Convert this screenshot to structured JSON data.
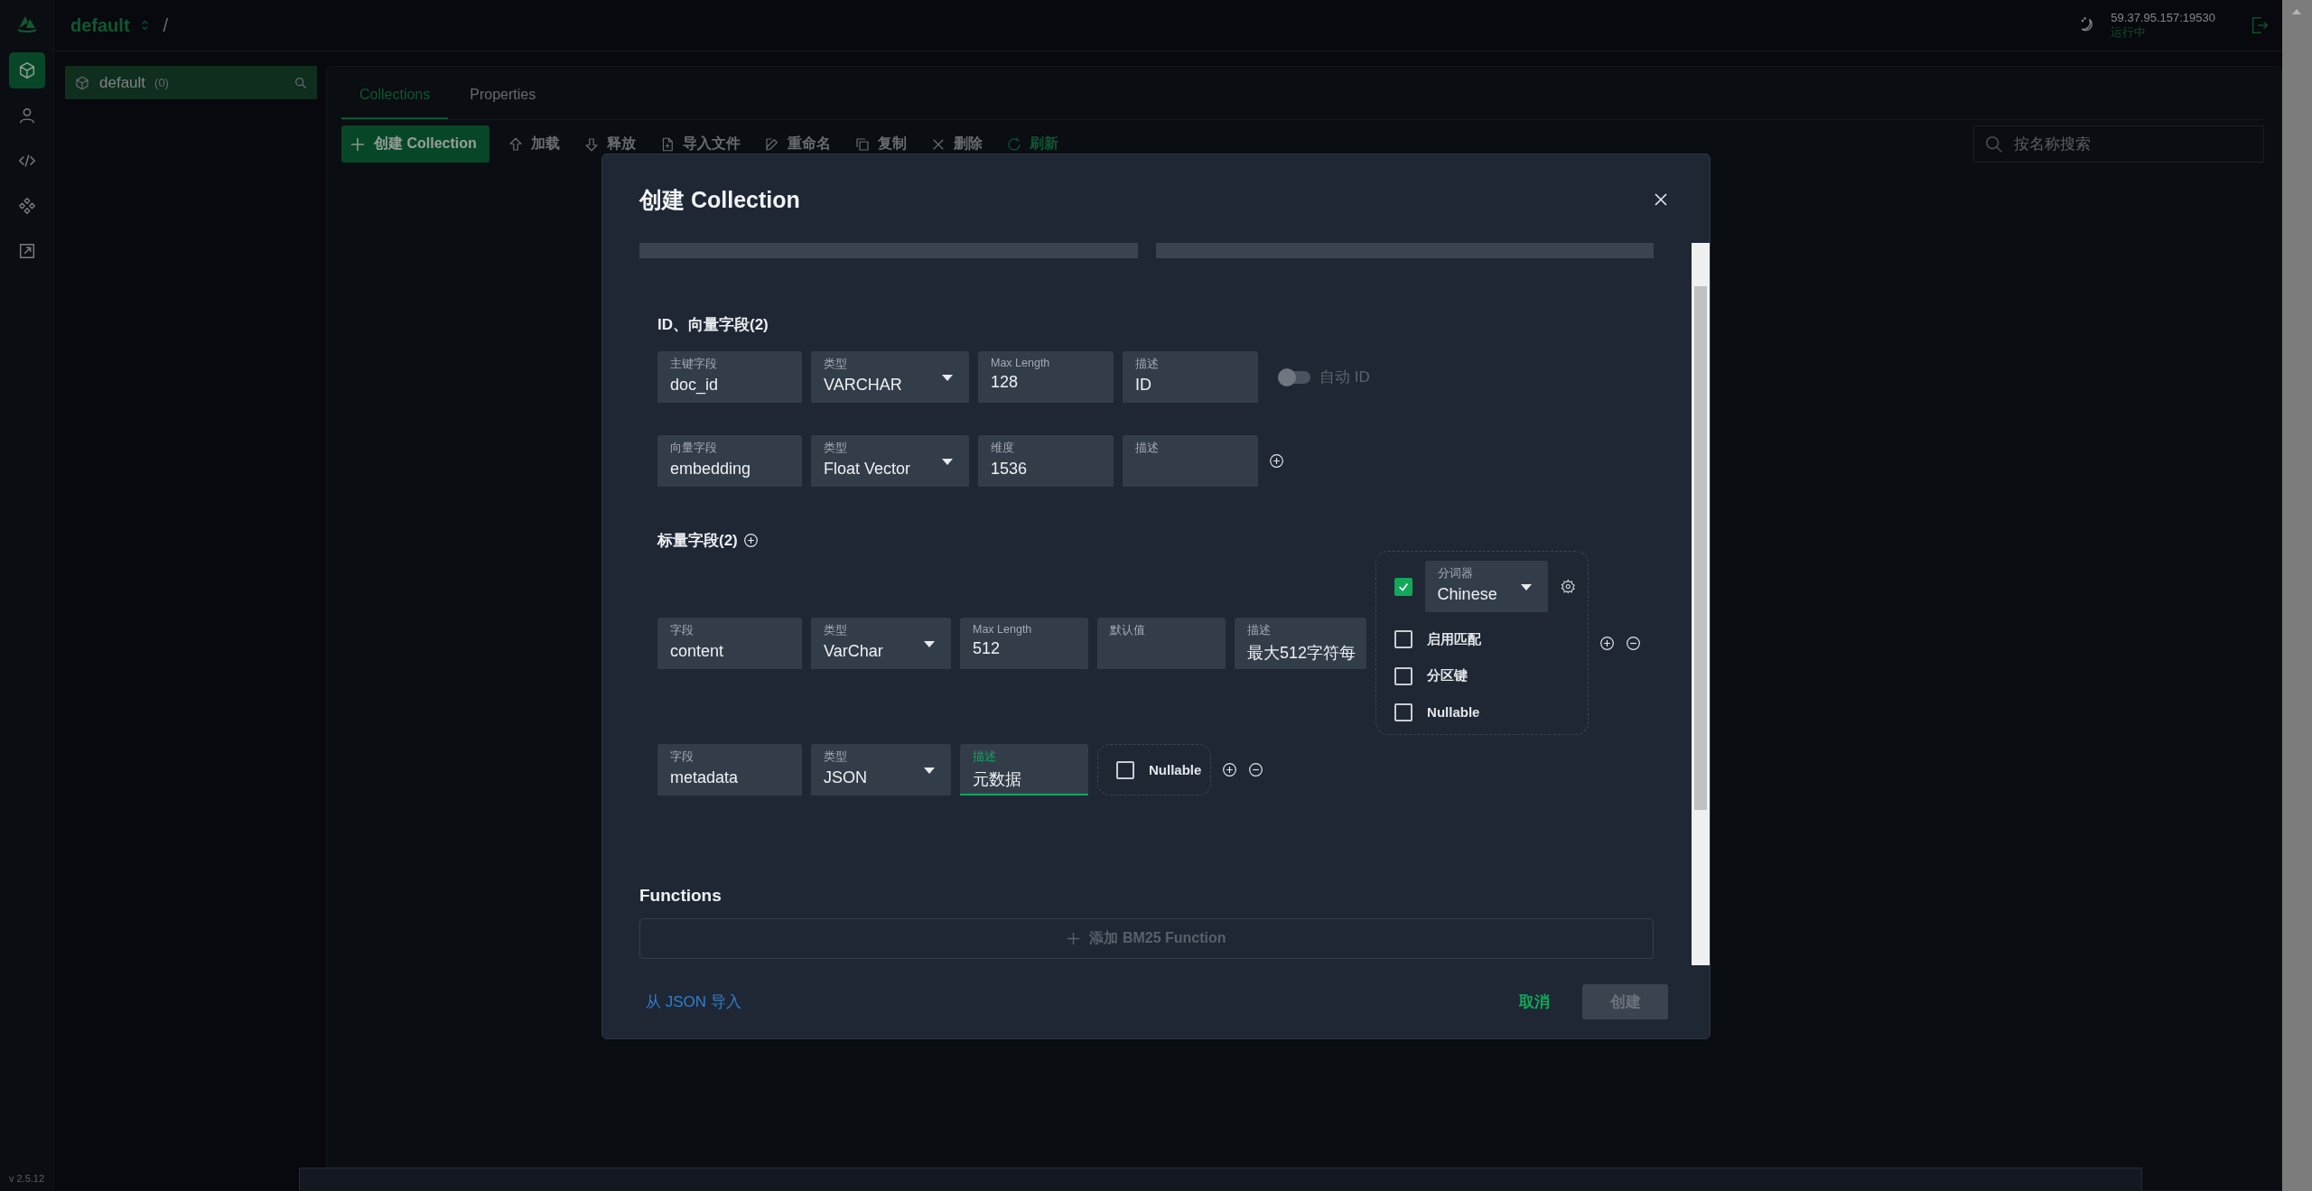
{
  "header": {
    "database": "default",
    "separator": "/",
    "server": "59.37.95.157:19530",
    "status": "运行中"
  },
  "nav": [
    {
      "selected": true
    },
    {
      "selected": false
    },
    {
      "selected": false
    },
    {
      "selected": false
    },
    {
      "selected": false
    }
  ],
  "version": "v 2.5.12",
  "tree": [
    {
      "label": "default",
      "count": "(0)",
      "selected": true
    }
  ],
  "tabs": [
    {
      "label": "Collections",
      "selected": true
    },
    {
      "label": "Properties",
      "selected": false
    }
  ],
  "toolbar": {
    "create": "创建 Collection",
    "actions": [
      {
        "label": "加载",
        "disabled": true
      },
      {
        "label": "释放",
        "disabled": true
      },
      {
        "label": "导入文件",
        "disabled": true
      },
      {
        "label": "重命名",
        "disabled": true
      },
      {
        "label": "复制",
        "disabled": true
      },
      {
        "label": "删除",
        "disabled": true
      },
      {
        "label": "刷新",
        "disabled": false
      }
    ]
  },
  "search": {
    "placeholder": "按名称搜索"
  },
  "dialog": {
    "title": "创建 Collection",
    "sections": [
      {
        "title": "ID、向量字段(2)",
        "rows": [
          {
            "fields": [
              {
                "kind": "text",
                "label": "主键字段",
                "value": "doc_id",
                "focused": false
              },
              {
                "kind": "select",
                "label": "类型",
                "value": "VARCHAR",
                "focused": false
              },
              {
                "kind": "text",
                "label": "Max Length",
                "value": "128",
                "focused": false
              },
              {
                "kind": "text",
                "label": "描述",
                "value": "ID",
                "focused": false
              }
            ],
            "extras": [
              {
                "kind": "toggle",
                "label": "自动 ID",
                "on": false
              }
            ]
          },
          {
            "fields": [
              {
                "kind": "text",
                "label": "向量字段",
                "value": "embedding",
                "focused": false
              },
              {
                "kind": "select",
                "label": "类型",
                "value": "Float Vector",
                "focused": false
              },
              {
                "kind": "text",
                "label": "维度",
                "value": "1536",
                "focused": false
              },
              {
                "kind": "text",
                "label": "描述",
                "focused": false
              }
            ],
            "extras": [
              {
                "kind": "add"
              }
            ]
          }
        ]
      },
      {
        "title": "标量字段(2)",
        "add": true,
        "rows": [
          {
            "fields": [
              {
                "kind": "text",
                "label": "字段",
                "value": "content",
                "focused": false
              },
              {
                "kind": "select",
                "label": "类型",
                "value": "VarChar",
                "focused": false
              },
              {
                "kind": "text",
                "label": "Max Length",
                "value": "512",
                "focused": false
              },
              {
                "kind": "text",
                "label": "默认值",
                "focused": false
              },
              {
                "kind": "text",
                "label": "描述",
                "value": "最大512字符每",
                "focused": false
              }
            ],
            "extras": [
              {
                "kind": "options",
                "analyzer": {
                  "checked": true,
                  "label": "分词器",
                  "value": "Chinese"
                },
                "checks": [
                  {
                    "label": "启用匹配",
                    "checked": false
                  },
                  {
                    "label": "分区键",
                    "checked": false
                  },
                  {
                    "label": "Nullable",
                    "checked": false
                  }
                ]
              },
              {
                "kind": "add"
              },
              {
                "kind": "remove"
              }
            ]
          },
          {
            "fields": [
              {
                "kind": "text",
                "label": "字段",
                "value": "metadata",
                "focused": false
              },
              {
                "kind": "select",
                "label": "类型",
                "value": "JSON",
                "focused": false
              },
              {
                "kind": "text",
                "label": "描述",
                "value": "元数据",
                "focused": true
              }
            ],
            "extras": [
              {
                "kind": "options",
                "checks": [
                  {
                    "label": "Nullable",
                    "checked": false
                  }
                ]
              },
              {
                "kind": "add"
              },
              {
                "kind": "remove"
              }
            ]
          }
        ]
      }
    ],
    "functions": {
      "title": "Functions",
      "add": "添加 BM25 Function"
    },
    "footer": {
      "import": "从 JSON 导入",
      "cancel": "取消",
      "create": "创建",
      "create_disabled": true
    }
  }
}
